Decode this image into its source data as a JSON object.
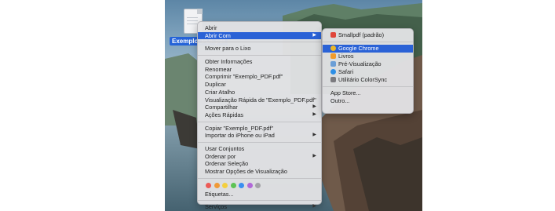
{
  "desktop": {
    "file_label": "Exemplo_PDF.pdf"
  },
  "context_menu": {
    "items": [
      {
        "label": "Abrir"
      },
      {
        "label": "Abrir Com",
        "has_submenu": true,
        "highlighted": true
      },
      {
        "label": "Mover para o Lixo"
      },
      {
        "label": "Obter Informações"
      },
      {
        "label": "Renomear"
      },
      {
        "label": "Comprimir \"Exemplo_PDF.pdf\""
      },
      {
        "label": "Duplicar"
      },
      {
        "label": "Criar Atalho"
      },
      {
        "label": "Visualização Rápida de \"Exemplo_PDF.pdf\""
      },
      {
        "label": "Compartilhar",
        "has_submenu": true
      },
      {
        "label": "Ações Rápidas",
        "has_submenu": true
      },
      {
        "label": "Copiar \"Exemplo_PDF.pdf\""
      },
      {
        "label": "Importar do iPhone ou iPad",
        "has_submenu": true
      },
      {
        "label": "Usar Conjuntos"
      },
      {
        "label": "Ordenar por",
        "has_submenu": true
      },
      {
        "label": "Ordenar Seleção"
      },
      {
        "label": "Mostrar Opções de Visualização"
      },
      {
        "label": "Etiquetas..."
      },
      {
        "label": "Serviços",
        "has_submenu": true
      }
    ],
    "tag_colors": [
      "#ec5b57",
      "#f09a37",
      "#f4cf3f",
      "#5dc354",
      "#3a8ff0",
      "#b168d8",
      "#a3a3a7"
    ]
  },
  "submenu": {
    "items": [
      {
        "label": "Smallpdf (padrão)",
        "icon": "smallpdf-icon",
        "color": "#e0463a"
      },
      {
        "label": "Google Chrome",
        "icon": "chrome-icon",
        "color": "#e9b72a",
        "highlighted": true
      },
      {
        "label": "Livros",
        "icon": "books-icon",
        "color": "#f29b2b"
      },
      {
        "label": "Pré-Visualização",
        "icon": "preview-icon",
        "color": "#6a9ed6"
      },
      {
        "label": "Safari",
        "icon": "safari-icon",
        "color": "#2d8fe6"
      },
      {
        "label": "Utilitário ColorSync",
        "icon": "colorsync-icon",
        "color": "#7b7b7f"
      },
      {
        "label": "App Store..."
      },
      {
        "label": "Outro..."
      }
    ]
  }
}
